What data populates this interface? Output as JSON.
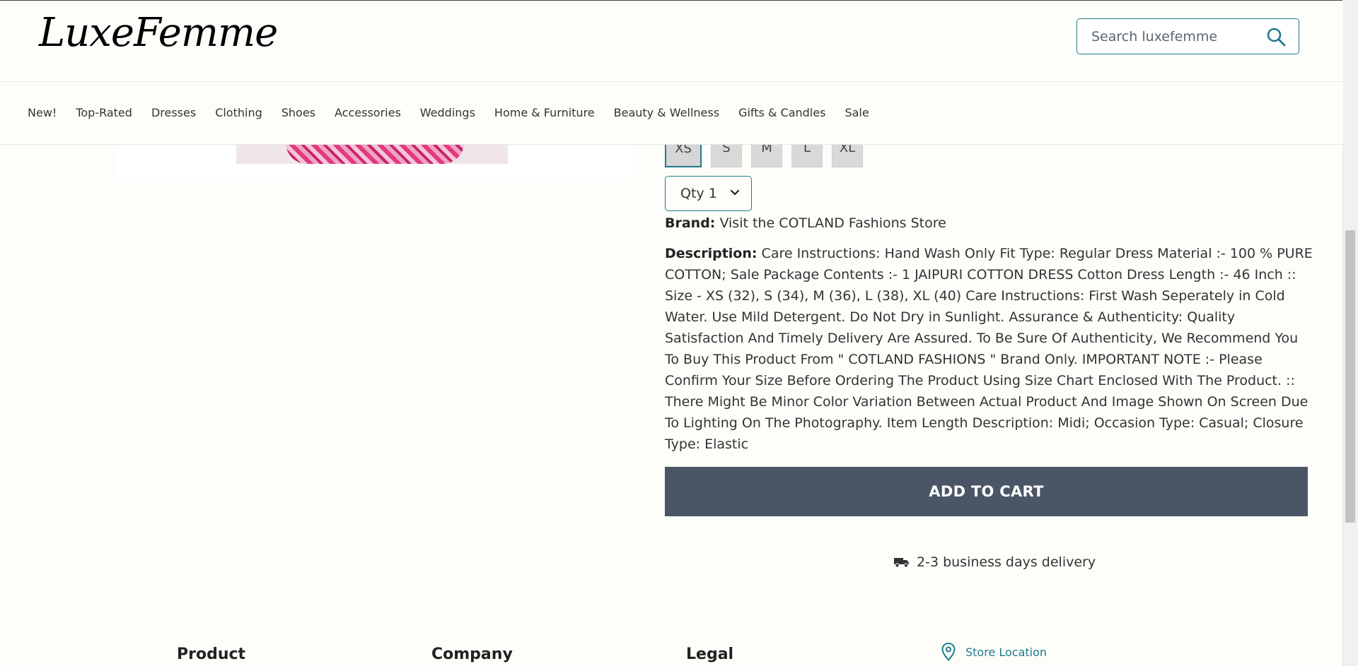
{
  "header": {
    "logo_text": "LuxeFemme",
    "search_placeholder": "Search luxefemme"
  },
  "nav": {
    "items": [
      "New!",
      "Top-Rated",
      "Dresses",
      "Clothing",
      "Shoes",
      "Accessories",
      "Weddings",
      "Home & Furniture",
      "Beauty & Wellness",
      "Gifts & Candles",
      "Sale"
    ]
  },
  "product": {
    "sizes": [
      "XS",
      "S",
      "M",
      "L",
      "XL"
    ],
    "selected_size": "XS",
    "quantity_label": "Qty 1",
    "brand_label": "Brand:",
    "brand_value": "Visit the COTLAND Fashions Store",
    "description_label": "Description:",
    "description_text": "Care Instructions: Hand Wash Only Fit Type: Regular Dress Material :- 100 % PURE COTTON; Sale Package Contents :- 1 JAIPURI COTTON DRESS Cotton Dress Length :- 46 Inch :: Size - XS (32), S (34), M (36), L (38), XL (40) Care Instructions: First Wash Seperately in Cold Water. Use Mild Detergent. Do Not Dry in Sunlight. Assurance & Authenticity: Quality Satisfaction And Timely Delivery Are Assured. To Be Sure Of Authenticity, We Recommend You To Buy This Product From \" COTLAND FASHIONS \" Brand Only. IMPORTANT NOTE :- Please Confirm Your Size Before Ordering The Product Using Size Chart Enclosed With The Product. :: There Might Be Minor Color Variation Between Actual Product And Image Shown On Screen Due To Lighting On The Photography. Item Length Description: Midi; Occasion Type: Casual; Closure Type: Elastic",
    "add_to_cart_label": "ADD TO CART",
    "delivery_text": "2-3 business days delivery"
  },
  "footer": {
    "col_product": "Product",
    "col_company": "Company",
    "col_legal": "Legal",
    "store_location": "Store Location"
  },
  "colors": {
    "accent": "#1f7a8c",
    "button_bg": "#4a5666",
    "page_bg": "#fdfdf9"
  },
  "icons": [
    "search-icon",
    "chevron-down-icon",
    "truck-icon",
    "map-pin-icon"
  ]
}
